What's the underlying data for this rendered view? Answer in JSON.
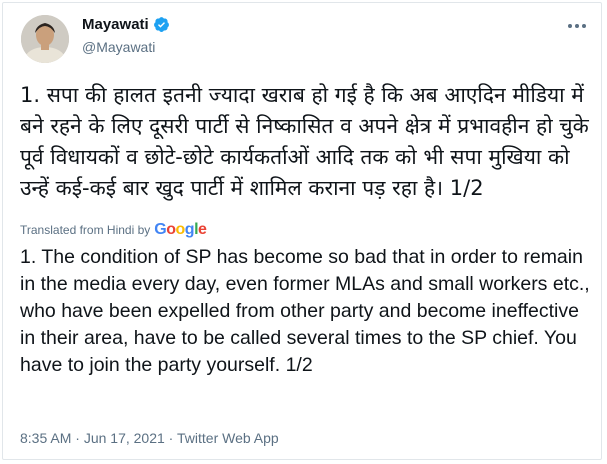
{
  "author": {
    "name": "Mayawati",
    "handle": "@Mayawati",
    "verified": true
  },
  "tweet": {
    "original_text": "1. सपा की हालत इतनी ज्यादा खराब हो गई है कि अब आएदिन मीडिया में बने रहने के लिए दूसरी पार्टी से निष्कासित व अपने क्षेत्र में प्रभावहीन हो चुके पूर्व विधायकों व छोटे-छोटे कार्यकर्ताओं आदि तक को भी सपा मुखिया को उन्हें कई-कई बार खुद पार्टी में शामिल कराना पड़ रहा है। 1/2",
    "translated_from_label": "Translated from Hindi by",
    "translator_brand": "Google",
    "translated_text": "1. The condition of SP has become so bad that in order to remain in the media every day, even former MLAs and small workers etc., who have been expelled from other party and become ineffective in their area, have to be called several times to the SP chief. You have to join the party yourself. 1/2"
  },
  "meta": {
    "time": "8:35 AM",
    "separator": " · ",
    "date": "Jun 17, 2021",
    "source": "Twitter Web App"
  },
  "colors": {
    "verified_blue": "#1da1f2",
    "secondary_text": "#5b7083"
  },
  "icons": {
    "more": "more-options-icon",
    "verified": "verified-badge-icon"
  }
}
